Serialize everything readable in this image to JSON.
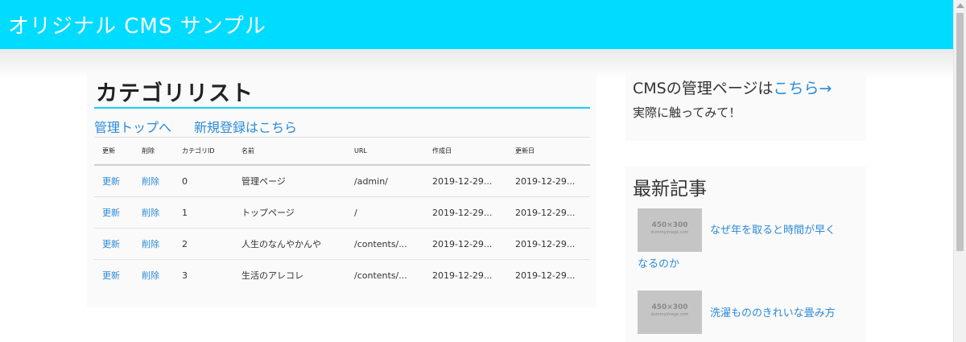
{
  "header": {
    "site_title": "オリジナル CMS サンプル"
  },
  "main": {
    "title": "カテゴリリスト",
    "links": {
      "admin_top": "管理トップへ",
      "new_register": "新規登録はこちら"
    },
    "table": {
      "columns": [
        "更新",
        "削除",
        "カテゴリID",
        "名前",
        "URL",
        "作成日",
        "更新日"
      ],
      "rows": [
        {
          "update": "更新",
          "delete": "削除",
          "id": "0",
          "name": "管理ページ",
          "url": "/admin/",
          "created": "2019-12-29...",
          "updated": "2019-12-29..."
        },
        {
          "update": "更新",
          "delete": "削除",
          "id": "1",
          "name": "トップページ",
          "url": "/",
          "created": "2019-12-29...",
          "updated": "2019-12-29..."
        },
        {
          "update": "更新",
          "delete": "削除",
          "id": "2",
          "name": "人生のなんやかんや",
          "url": "/contents/...",
          "created": "2019-12-29...",
          "updated": "2019-12-29..."
        },
        {
          "update": "更新",
          "delete": "削除",
          "id": "3",
          "name": "生活のアレコレ",
          "url": "/contents/...",
          "created": "2019-12-29...",
          "updated": "2019-12-29..."
        }
      ]
    }
  },
  "sidebar": {
    "admin_box": {
      "text": "CMSの管理ページは",
      "link": "こちら→",
      "subtext": "実際に触ってみて！"
    },
    "latest": {
      "heading": "最新記事",
      "articles": [
        {
          "thumb_main": "450×300",
          "thumb_sub": "dummyimage.com",
          "title_line1": "なぜ年を取ると時間が早く",
          "title_line2": "なるのか"
        },
        {
          "thumb_main": "450×300",
          "thumb_sub": "dummyimage.com",
          "title_line1": "洗濯もののきれいな畳み方"
        }
      ]
    }
  },
  "colors": {
    "header_bg": "#00dcff",
    "link": "#2b8ad8",
    "accent_rule": "#14d0f4"
  }
}
